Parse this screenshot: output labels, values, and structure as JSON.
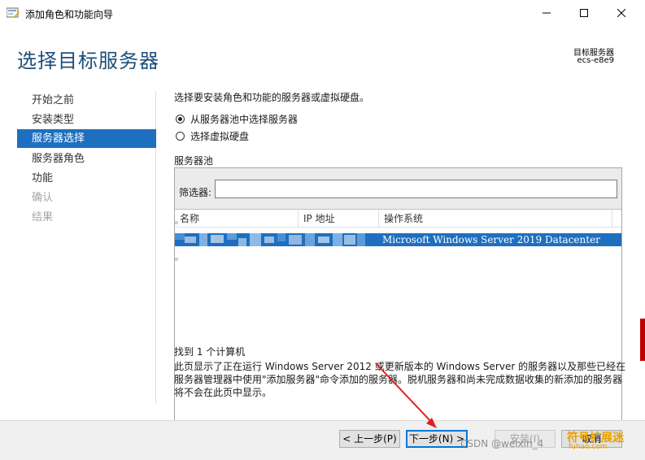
{
  "window": {
    "title": "添加角色和功能向导",
    "icon": "server-wizard-icon"
  },
  "header": {
    "page_title": "选择目标服务器",
    "destination_label": "目标服务器",
    "destination_value": "ecs-e8e9"
  },
  "sidebar": {
    "items": [
      {
        "label": "开始之前",
        "state": "normal"
      },
      {
        "label": "安装类型",
        "state": "normal"
      },
      {
        "label": "服务器选择",
        "state": "active"
      },
      {
        "label": "服务器角色",
        "state": "normal"
      },
      {
        "label": "功能",
        "state": "normal"
      },
      {
        "label": "确认",
        "state": "disabled"
      },
      {
        "label": "结果",
        "state": "disabled"
      }
    ]
  },
  "content": {
    "intro": "选择要安装角色和功能的服务器或虚拟硬盘。",
    "radio_pool": "从服务器池中选择服务器",
    "radio_vhd": "选择虚拟硬盘",
    "pool_title": "服务器池",
    "filter_label": "筛选器:",
    "filter_value": "",
    "columns": {
      "name": "名称",
      "ip": "IP 地址",
      "os": "操作系统"
    },
    "rows": [
      {
        "name": "",
        "ip": "",
        "os": "Microsoft Windows Server 2019 Datacenter",
        "selected": true
      }
    ],
    "found": "找到 1 个计算机",
    "description": "此页显示了正在运行 Windows Server 2012 或更新版本的 Windows Server 的服务器以及那些已经在服务器管理器中使用\"添加服务器\"命令添加的服务器。脱机服务器和尚未完成数据收集的新添加的服务器将不会在此页中显示。"
  },
  "buttons": {
    "prev": "< 上一步(P)",
    "next": "下一步(N) >",
    "install": "安装(I)",
    "cancel": "取消"
  },
  "watermarks": {
    "csdn": "CSDN @weixin_4",
    "site_name": "符号扩展迷",
    "site_url": "fuhao.com"
  },
  "colors": {
    "accent": "#1e6fbf",
    "title_blue": "#1e4e79",
    "arrow_red": "#e02020"
  }
}
